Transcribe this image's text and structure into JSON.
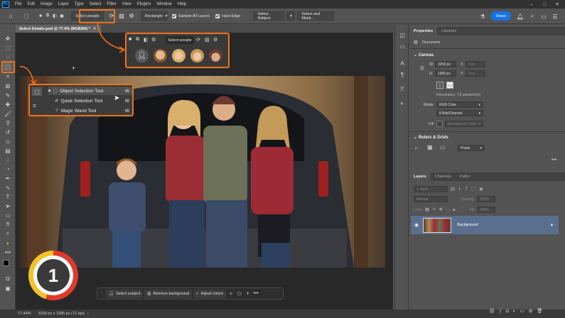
{
  "menu": {
    "items": [
      "File",
      "Edit",
      "Image",
      "Layer",
      "Type",
      "Select",
      "Filter",
      "View",
      "Plugins",
      "Window",
      "Help"
    ]
  },
  "options_bar": {
    "select_people": "Select people",
    "mode": "Rectangle",
    "sample_all_layers": "Sample All Layers",
    "hard_edge": "Hard Edge",
    "select_subject": "Select Subject",
    "select_and_mask": "Select and Mask...",
    "share": "Share"
  },
  "document": {
    "tab_title": "Select Details.psd @ 77.4% (RGB/8#) *"
  },
  "popup": {
    "label": "Select people"
  },
  "flyout": {
    "items": [
      {
        "label": "Object Selection Tool",
        "key": "W"
      },
      {
        "label": "Quick Selection Tool",
        "key": "W"
      },
      {
        "label": "Magic Wand Tool",
        "key": "W"
      }
    ]
  },
  "step_badge": "1",
  "taskbar": {
    "select_subject": "Select subject",
    "remove_background": "Remove background",
    "adjust_colors": "Adjust colors"
  },
  "status": {
    "zoom": "77.44%",
    "info": "3209 px x 1685 px (72 ppi)"
  },
  "properties": {
    "tabs": [
      "Properties",
      "Libraries"
    ],
    "doc_label": "Document",
    "canvas_header": "Canvas",
    "w_label": "W",
    "w_value": "3209 px",
    "h_label": "H",
    "h_value": "1685 px",
    "x_label": "X",
    "x_value": "0 px",
    "y_label": "Y",
    "y_value": "0 px",
    "resolution": "Resolution: 72 pixels/inch",
    "mode_label": "Mode",
    "mode_value": "RGB Color",
    "depth_value": "8 Bits/Channel",
    "fill_label": "Fill",
    "fill_value": "Background Color",
    "rulers_header": "Rulers & Grids",
    "units_value": "Pixels"
  },
  "layers": {
    "tabs": [
      "Layers",
      "Channels",
      "Paths"
    ],
    "kind": "Kind",
    "blend": "Normal",
    "opacity_label": "Opacity:",
    "opacity_value": "100%",
    "lock_label": "Lock:",
    "fill_label": "Fill:",
    "fill_value": "100%",
    "layer_name": "Background"
  },
  "colors": {
    "accent": "#f2711c",
    "share": "#1473e6",
    "layer_selected": "#5a6f8e"
  }
}
